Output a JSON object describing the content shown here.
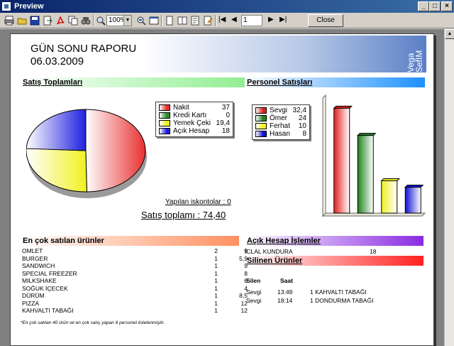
{
  "window": {
    "title": "Preview",
    "min": "_",
    "max": "□",
    "close": "×"
  },
  "toolbar": {
    "zoom": "100%",
    "page": "1",
    "close_label": "Close"
  },
  "report": {
    "title": "GÜN SONU RAPORU",
    "date": "06.03.2009",
    "logo": "Vega SefIM",
    "sales_section": "Satış Toplamları",
    "staff_section": "Personel Satışları",
    "top_products_section": "En çok satılan ürünler",
    "open_accounts_section": "Açık Hesap İşlemler",
    "deleted_section": "Silinen Ürünler",
    "discount_text": "Yapılan iskontolar : 0",
    "total_text": "Satış toplamı : 74,40",
    "footnote": "*En çok satılan 40 ürün ve en çok satış yapan 6 personel listelenmiştir.",
    "deleted_headers": {
      "staff": "Silen",
      "time": "Saat"
    }
  },
  "payment_legend": [
    {
      "label": "Nakit",
      "value": "37",
      "color": "#e83030"
    },
    {
      "label": "Kredi Kartı",
      "value": "0",
      "color": "#2e8b2e"
    },
    {
      "label": "Yemek Çeki",
      "value": "19,4",
      "color": "#f0f020"
    },
    {
      "label": "Açık Hesap",
      "value": "18",
      "color": "#2020e0"
    }
  ],
  "staff_legend": [
    {
      "label": "Sevgi",
      "value": "32,4",
      "color": "#e02020"
    },
    {
      "label": "Ömer",
      "value": "24",
      "color": "#208020"
    },
    {
      "label": "Ferhat",
      "value": "10",
      "color": "#f0f020"
    },
    {
      "label": "Hasan",
      "value": "8",
      "color": "#1010d0"
    }
  ],
  "products": [
    {
      "name": "OMLET",
      "qty": "2",
      "amount": "9"
    },
    {
      "name": "BURGER",
      "qty": "1",
      "amount": "5,9"
    },
    {
      "name": "SANDWICH",
      "qty": "1",
      "amount": "9"
    },
    {
      "name": "SPECIAL FREEZER",
      "qty": "1",
      "amount": "8"
    },
    {
      "name": "MILKSHAKE",
      "qty": "1",
      "amount": "6"
    },
    {
      "name": "SOĞUK İÇECEK",
      "qty": "1",
      "amount": "4"
    },
    {
      "name": "DÜRÜM",
      "qty": "1",
      "amount": "8,5"
    },
    {
      "name": "PIZZA",
      "qty": "1",
      "amount": "12"
    },
    {
      "name": "KAHVALTI TABAĞI",
      "qty": "1",
      "amount": "12"
    }
  ],
  "open_accounts": [
    {
      "name": "ICLAL KUNDURA",
      "amount": "18"
    }
  ],
  "deleted_items": [
    {
      "staff": "Sevgi",
      "time": "13:49",
      "item": "1 KAHVALTI TABAĞI"
    },
    {
      "staff": "Sevgi",
      "time": "18:14",
      "item": "1 DONDURMA TABAĞI"
    }
  ],
  "chart_data": [
    {
      "type": "pie",
      "title": "Satış Toplamları",
      "categories": [
        "Nakit",
        "Kredi Kartı",
        "Yemek Çeki",
        "Açık Hesap"
      ],
      "values": [
        37,
        0,
        19.4,
        18
      ],
      "colors": [
        "#e83030",
        "#2e8b2e",
        "#f0f020",
        "#2020e0"
      ],
      "legend": "right"
    },
    {
      "type": "bar",
      "title": "Personel Satışları",
      "categories": [
        "Sevgi",
        "Ömer",
        "Ferhat",
        "Hasan"
      ],
      "values": [
        32.4,
        24,
        10,
        8
      ],
      "colors": [
        "#e02020",
        "#208020",
        "#f0f020",
        "#1010d0"
      ],
      "ylim": [
        0,
        36
      ],
      "grid": false,
      "legend": "left"
    }
  ]
}
